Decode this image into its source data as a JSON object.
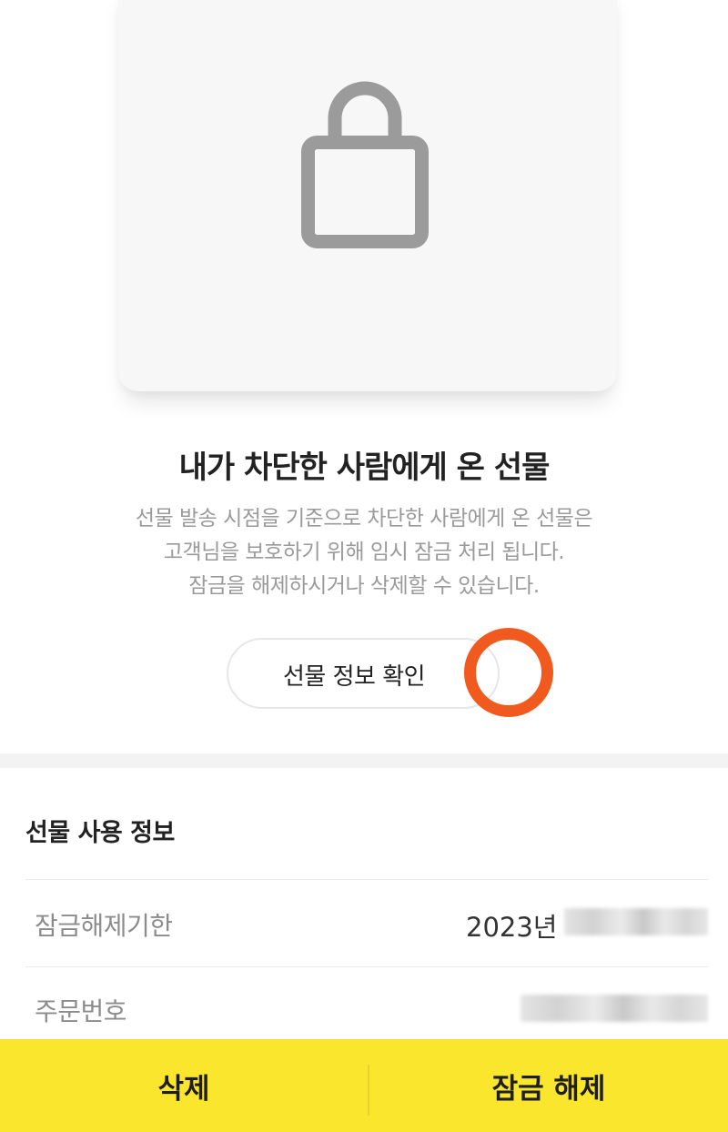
{
  "card": {
    "icon": "lock-icon",
    "background": "#f7f7f7"
  },
  "blocked_gift": {
    "title": "내가 차단한 사람에게 온 선물",
    "description_lines": [
      "선물 발송 시점을 기준으로 차단한 사람에게 온 선물은",
      "고객님을 보호하기 위해 임시 잠금 처리 됩니다.",
      "잠금을 해제하시거나 삭제할 수 있습니다."
    ],
    "info_button_label": "선물 정보 확인",
    "highlight_color": "#f05a1e"
  },
  "usage_info": {
    "section_title": "선물 사용 정보",
    "rows": [
      {
        "label": "잠금해제기한",
        "value": "2023년"
      },
      {
        "label": "주문번호",
        "value": ""
      }
    ]
  },
  "actions": {
    "delete_label": "삭제",
    "unlock_label": "잠금 해제",
    "bar_color": "#fbe62e"
  }
}
